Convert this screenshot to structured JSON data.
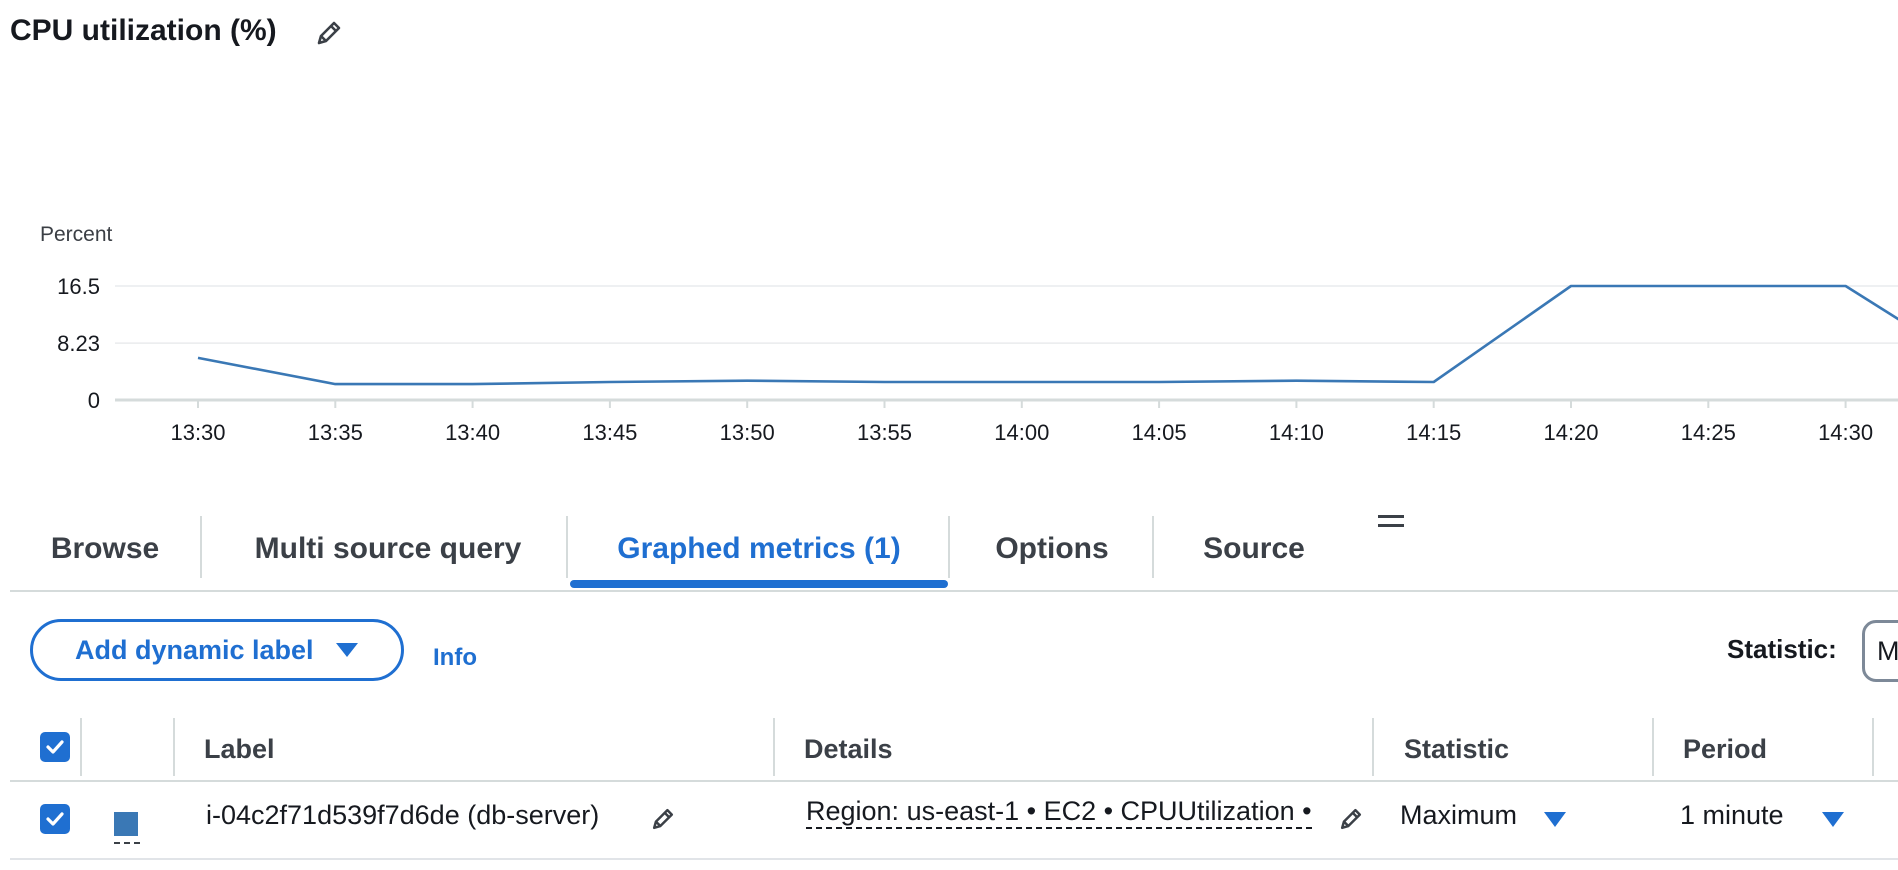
{
  "widget": {
    "title": "CPU utilization (%)"
  },
  "colors": {
    "accent": "#1f6fd1",
    "series": "#3a78b5",
    "grid": "#e9ebed",
    "text": "#16191f"
  },
  "chart_data": {
    "type": "line",
    "ylabel": "Percent",
    "y_ticks": [
      "0",
      "8.23",
      "16.5"
    ],
    "ylim": [
      0,
      16.5
    ],
    "x_ticks": [
      "13:30",
      "13:35",
      "13:40",
      "13:45",
      "13:50",
      "13:55",
      "14:00",
      "14:05",
      "14:10",
      "14:15",
      "14:20",
      "14:25",
      "14:30"
    ],
    "series": [
      {
        "x": [
          "13:30",
          "13:35",
          "13:40",
          "13:45",
          "13:50",
          "13:55",
          "14:00",
          "14:05",
          "14:10",
          "14:15",
          "14:20",
          "14:25",
          "14:30",
          "14:32"
        ],
        "values": [
          6.1,
          2.3,
          2.3,
          2.6,
          2.8,
          2.6,
          2.6,
          2.6,
          2.8,
          2.6,
          16.5,
          16.5,
          16.5,
          11.5
        ]
      }
    ]
  },
  "tabs": [
    {
      "label": "Browse",
      "active": false
    },
    {
      "label": "Multi source query",
      "active": false
    },
    {
      "label": "Graphed metrics (1)",
      "active": true
    },
    {
      "label": "Options",
      "active": false
    },
    {
      "label": "Source",
      "active": false
    }
  ],
  "toolbar": {
    "add_label_button": "Add dynamic label",
    "info_link": "Info",
    "statistic_label": "Statistic:",
    "statistic_value": "M"
  },
  "table": {
    "headers": {
      "label": "Label",
      "details": "Details",
      "statistic": "Statistic",
      "period": "Period"
    },
    "rows": [
      {
        "checked": true,
        "label": "i-04c2f71d539f7d6de (db-server)",
        "details": "Region: us-east-1 • EC2 • CPUUtilization •",
        "statistic": "Maximum",
        "period": "1 minute"
      }
    ]
  }
}
